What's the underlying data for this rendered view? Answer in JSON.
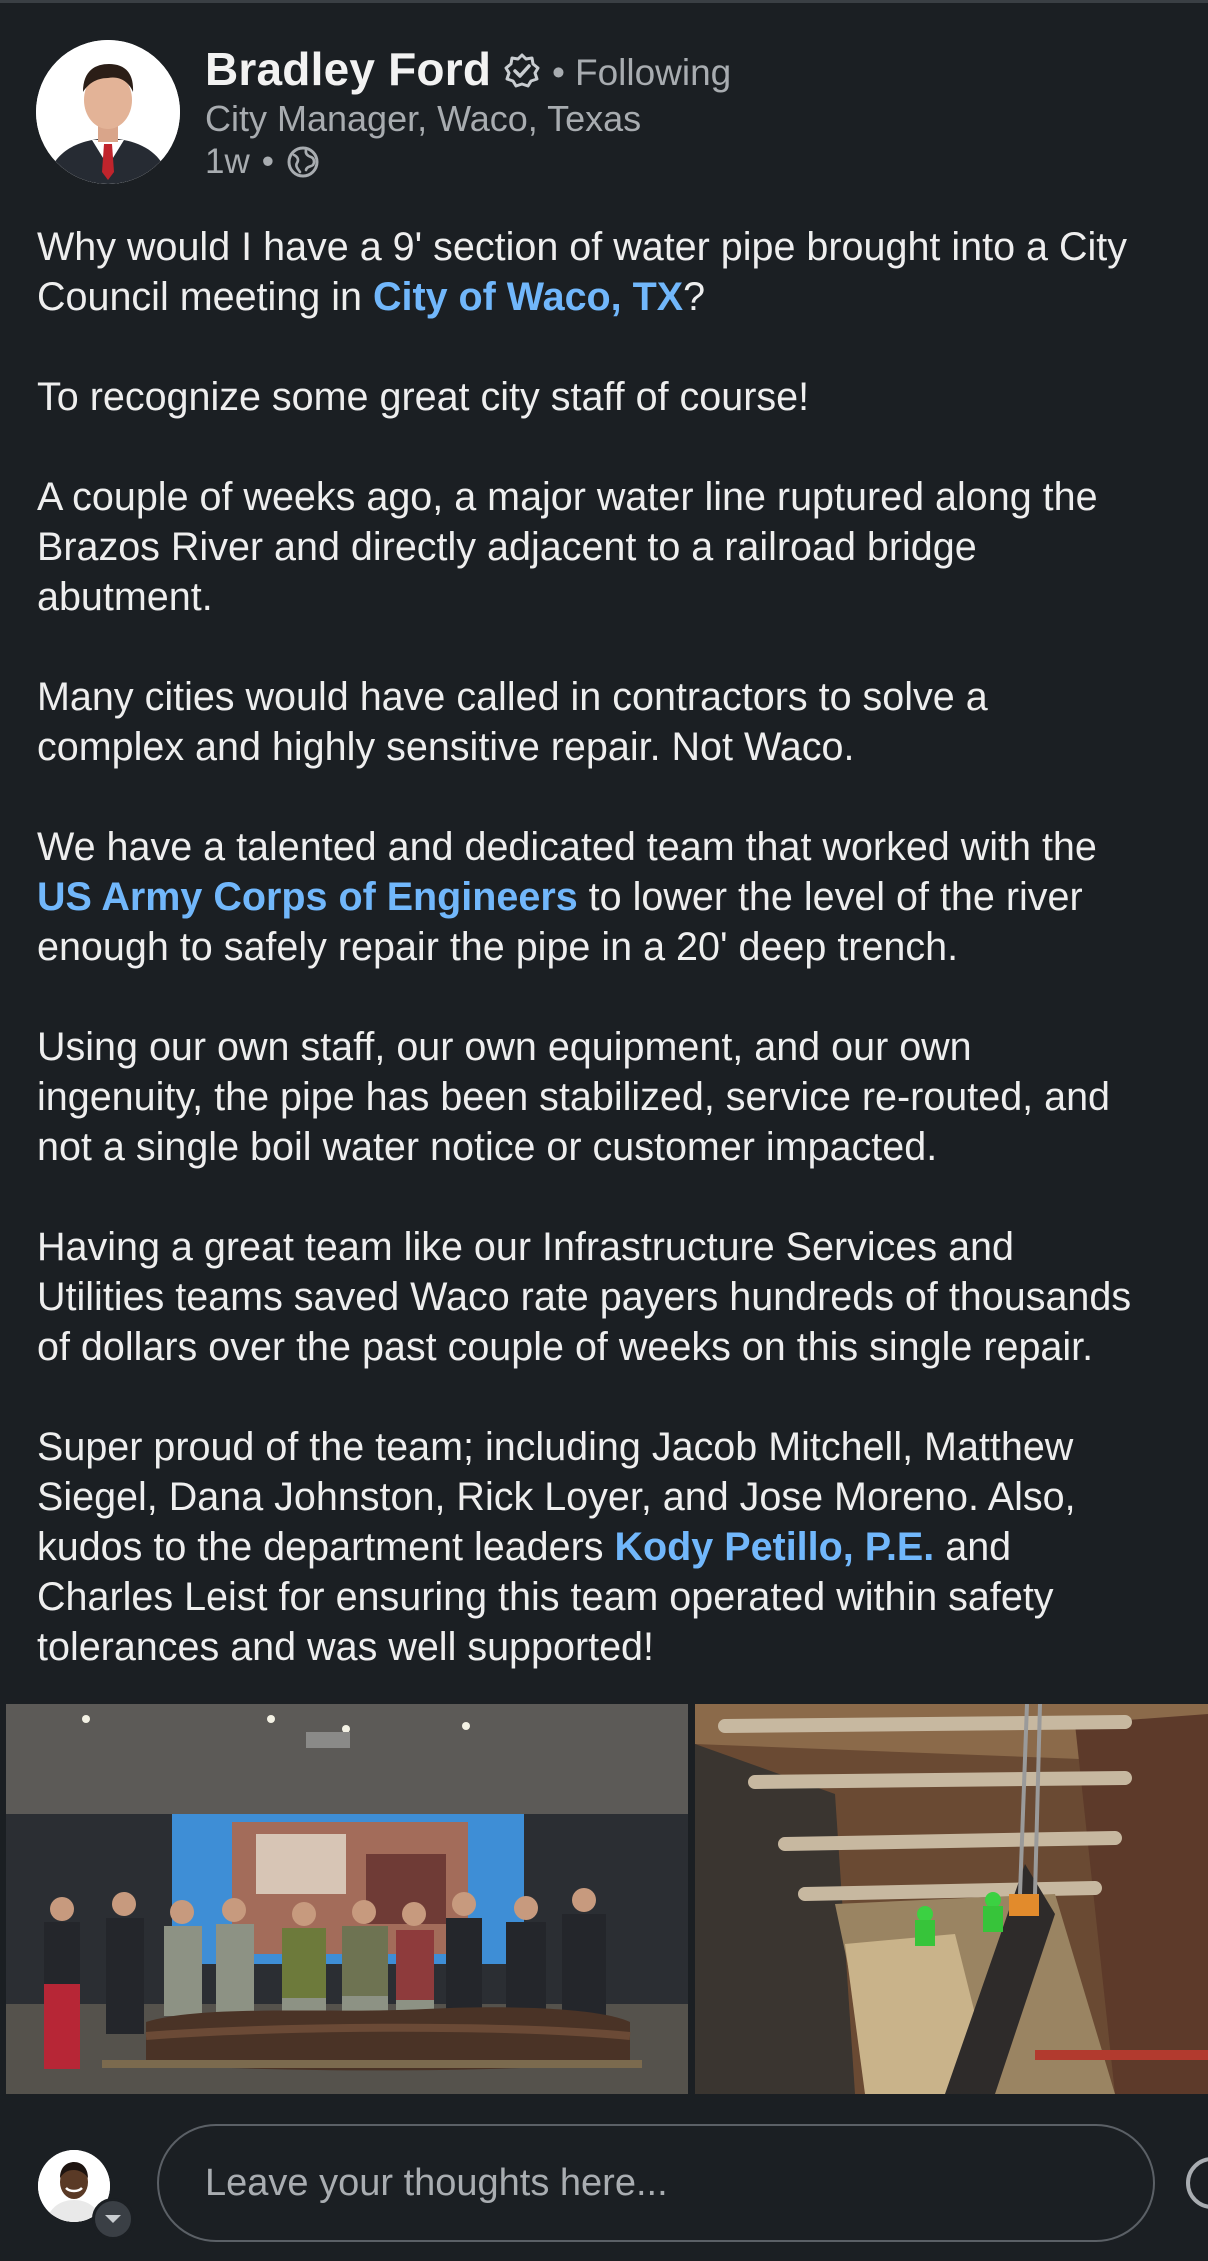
{
  "post": {
    "author": {
      "name": "Bradley Ford",
      "headline": "City Manager, Waco, Texas",
      "follow_dot": "•",
      "follow_status": "Following",
      "time": "1w",
      "time_sep": "•"
    },
    "body": {
      "p1_a": "Why would I have a 9' section of water pipe brought into a City",
      "p1_b": "Council meeting in ",
      "p1_link": "City of Waco, TX",
      "p1_c": "?",
      "p2": "To recognize some great city staff of course!",
      "p3_a": "A couple of weeks ago, a major water line ruptured along the",
      "p3_b": "Brazos River and directly adjacent to a railroad bridge",
      "p3_c": "abutment.",
      "p4_a": "Many cities would have called in contractors to solve a",
      "p4_b": "complex and highly sensitive repair. Not Waco.",
      "p5_a": "We have a talented and dedicated team that worked with the",
      "p5_link": "US Army Corps of Engineers",
      "p5_b": " to lower the level of the river",
      "p5_c": "enough to safely repair the pipe in a 20' deep trench.",
      "p6_a": "Using our own staff, our own equipment, and our own",
      "p6_b": "ingenuity, the pipe has been stabilized, service re-routed, and",
      "p6_c": "not a single boil water notice or customer impacted.",
      "p7_a": "Having a great team like our Infrastructure Services and",
      "p7_b": "Utilities teams saved Waco rate payers hundreds of thousands",
      "p7_c": "of dollars over the past couple of weeks on this single repair.",
      "p8_a": "Super proud of the team; including Jacob Mitchell, Matthew",
      "p8_b": "Siegel, Dana Johnston, Rick Loyer, and Jose Moreno. Also,",
      "p8_c": "kudos to the department leaders ",
      "p8_link": "Kody Petillo, P.E.",
      "p8_d": " and",
      "p8_e": "Charles Leist for ensuring this team operated within safety",
      "p8_f": "tolerances and was well supported!"
    }
  },
  "comment": {
    "placeholder": "Leave your thoughts here..."
  },
  "icons": {
    "verified": "verified-badge-icon",
    "visibility": "globe-icon",
    "dropdown": "chevron-down-icon",
    "emoji": "emoji-icon"
  },
  "colors": {
    "background": "#1b1f23",
    "text": "#eeeeee",
    "secondary_text": "#a8acb0",
    "link": "#71b7fb"
  }
}
